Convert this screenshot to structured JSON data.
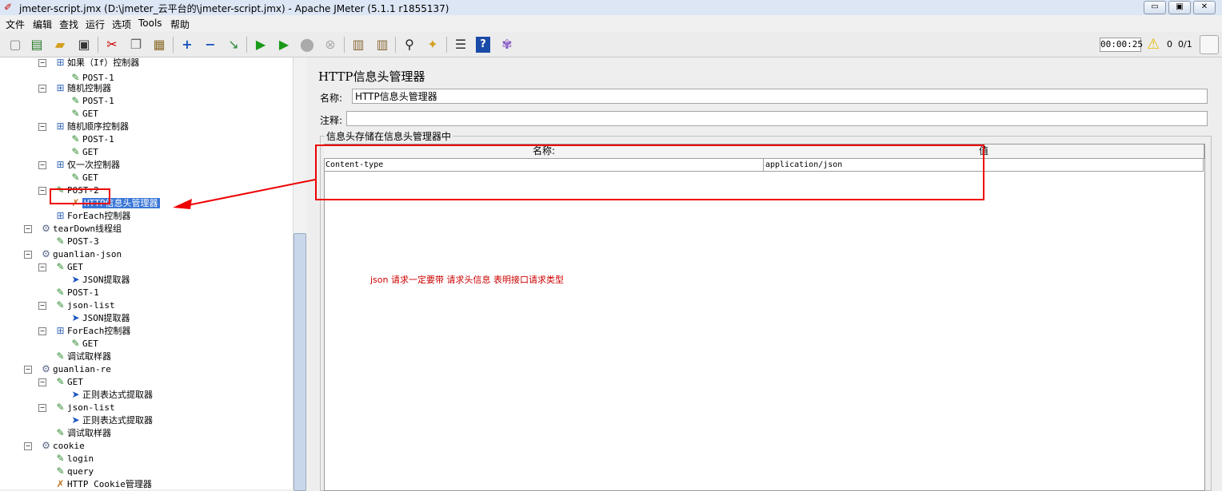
{
  "window": {
    "title": "jmeter-script.jmx (D:\\jmeter_云平台的\\jmeter-script.jmx) - Apache JMeter (5.1.1 r1855137)",
    "minimize": "▭",
    "restore": "▣",
    "close": "✕"
  },
  "menu": [
    "文件",
    "编辑",
    "查找",
    "运行",
    "选项",
    "Tools",
    "帮助"
  ],
  "status": {
    "timer": "00:00:25",
    "warnings": "0",
    "threads": "0/1"
  },
  "tree": [
    {
      "label": "如果（If）控制器",
      "icon": "controller-icon",
      "glyph": "⊞"
    },
    {
      "label": "POST-1",
      "icon": "sampler-icon",
      "glyph": "✎"
    },
    {
      "label": "随机控制器",
      "icon": "controller-icon",
      "glyph": "⊞"
    },
    {
      "label": "POST-1",
      "icon": "sampler-icon",
      "glyph": "✎"
    },
    {
      "label": "GET",
      "icon": "sampler-icon",
      "glyph": "✎"
    },
    {
      "label": "随机顺序控制器",
      "icon": "controller-icon",
      "glyph": "⊞"
    },
    {
      "label": "POST-1",
      "icon": "sampler-icon",
      "glyph": "✎"
    },
    {
      "label": "GET",
      "icon": "sampler-icon",
      "glyph": "✎"
    },
    {
      "label": "仅一次控制器",
      "icon": "controller-icon",
      "glyph": "⊞"
    },
    {
      "label": "GET",
      "icon": "sampler-icon",
      "glyph": "✎"
    },
    {
      "label": "POST-2",
      "icon": "sampler-icon",
      "glyph": "✎"
    },
    {
      "label": "HTTP信息头管理器",
      "icon": "header-manager-icon",
      "glyph": "✗"
    },
    {
      "label": "ForEach控制器",
      "icon": "controller-icon",
      "glyph": "⊞"
    },
    {
      "label": "tearDown线程组",
      "icon": "thread-group-icon",
      "glyph": "⚙"
    },
    {
      "label": "POST-3",
      "icon": "sampler-icon",
      "glyph": "✎"
    },
    {
      "label": "guanlian-json",
      "icon": "thread-group-icon",
      "glyph": "⚙"
    },
    {
      "label": "GET",
      "icon": "sampler-icon",
      "glyph": "✎"
    },
    {
      "label": "JSON提取器",
      "icon": "extractor-icon",
      "glyph": "➤"
    },
    {
      "label": "POST-1",
      "icon": "sampler-icon",
      "glyph": "✎"
    },
    {
      "label": "json-list",
      "icon": "sampler-icon",
      "glyph": "✎"
    },
    {
      "label": "JSON提取器",
      "icon": "extractor-icon",
      "glyph": "➤"
    },
    {
      "label": "ForEach控制器",
      "icon": "controller-icon",
      "glyph": "⊞"
    },
    {
      "label": "GET",
      "icon": "sampler-icon",
      "glyph": "✎"
    },
    {
      "label": "调试取样器",
      "icon": "sampler-icon",
      "glyph": "✎"
    },
    {
      "label": "guanlian-re",
      "icon": "thread-group-icon",
      "glyph": "⚙"
    },
    {
      "label": "GET",
      "icon": "sampler-icon",
      "glyph": "✎"
    },
    {
      "label": "正则表达式提取器",
      "icon": "extractor-icon",
      "glyph": "➤"
    },
    {
      "label": "json-list",
      "icon": "sampler-icon",
      "glyph": "✎"
    },
    {
      "label": "正则表达式提取器",
      "icon": "extractor-icon",
      "glyph": "➤"
    },
    {
      "label": "调试取样器",
      "icon": "sampler-icon",
      "glyph": "✎"
    },
    {
      "label": "cookie",
      "icon": "thread-group-icon",
      "glyph": "⚙"
    },
    {
      "label": "login",
      "icon": "sampler-icon",
      "glyph": "✎"
    },
    {
      "label": "query",
      "icon": "sampler-icon",
      "glyph": "✎"
    },
    {
      "label": "HTTP Cookie管理器",
      "icon": "cookie-manager-icon",
      "glyph": "✗"
    }
  ],
  "panel": {
    "title": "HTTP信息头管理器",
    "name_label": "名称:",
    "name_value": "HTTP信息头管理器",
    "comment_label": "注释:",
    "comment_value": "",
    "group_title": "信息头存储在信息头管理器中",
    "columns": [
      "名称:",
      "值"
    ],
    "rows": [
      {
        "name": "Content-type",
        "value": "application/json"
      }
    ]
  },
  "annotation": "json 请求一定要带 请求头信息     表明接口请求类型",
  "colors": {
    "annotation": "#cc0000",
    "highlight_box": "#ee0000",
    "selection": "#3875d7"
  }
}
